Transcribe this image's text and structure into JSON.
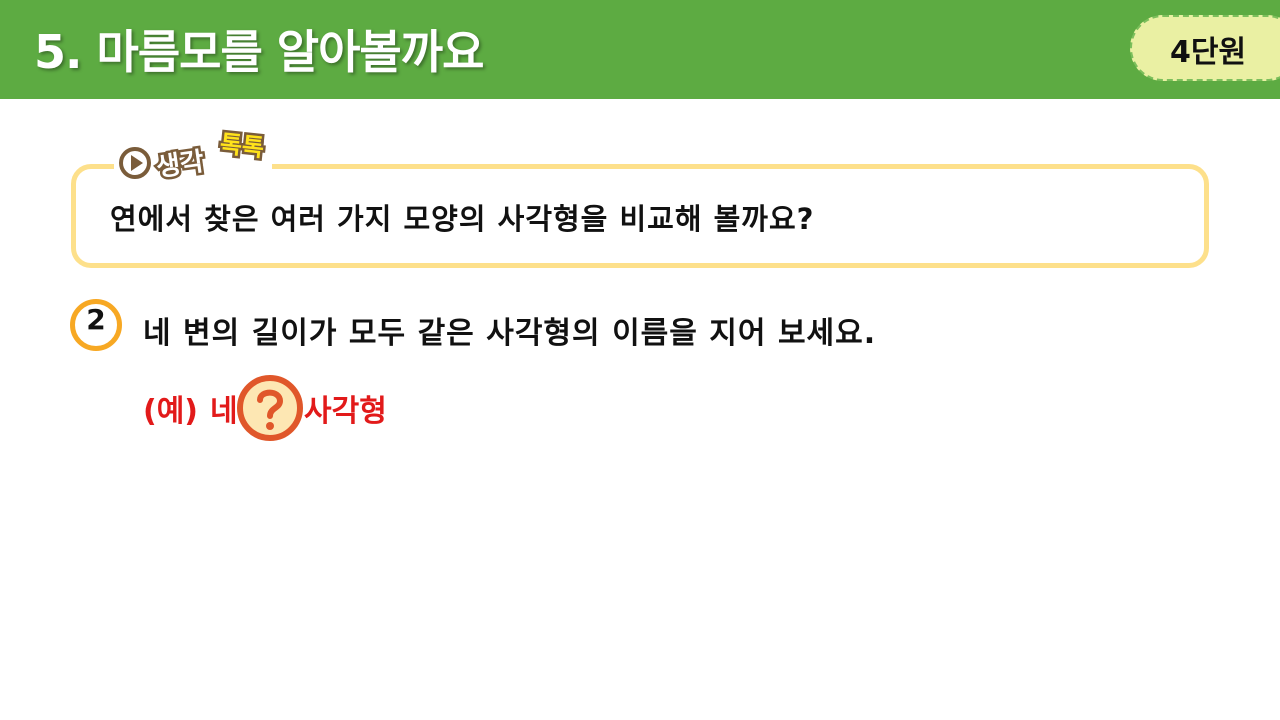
{
  "header": {
    "title": "5. 마름모를 알아볼까요",
    "unit_label": "4단원",
    "bg_color": "#5dab42"
  },
  "think_box": {
    "tag_word_1": "생각",
    "tag_word_2": "톡톡",
    "question": "연에서 찾은 여러 가지 모양의 사각형을 비교해 볼까요?",
    "border_color": "#fde08b",
    "icon": "play-icon"
  },
  "problem": {
    "number": "2",
    "text": "네 변의 길이가 모두 같은 사각형의 이름을 지어 보세요.",
    "number_ring_color": "#f7a823"
  },
  "answer": {
    "prefix": "(예)",
    "word": "네",
    "suffix": "사각형",
    "color": "#e21a1a",
    "hidden_icon": "question-mark-icon"
  }
}
